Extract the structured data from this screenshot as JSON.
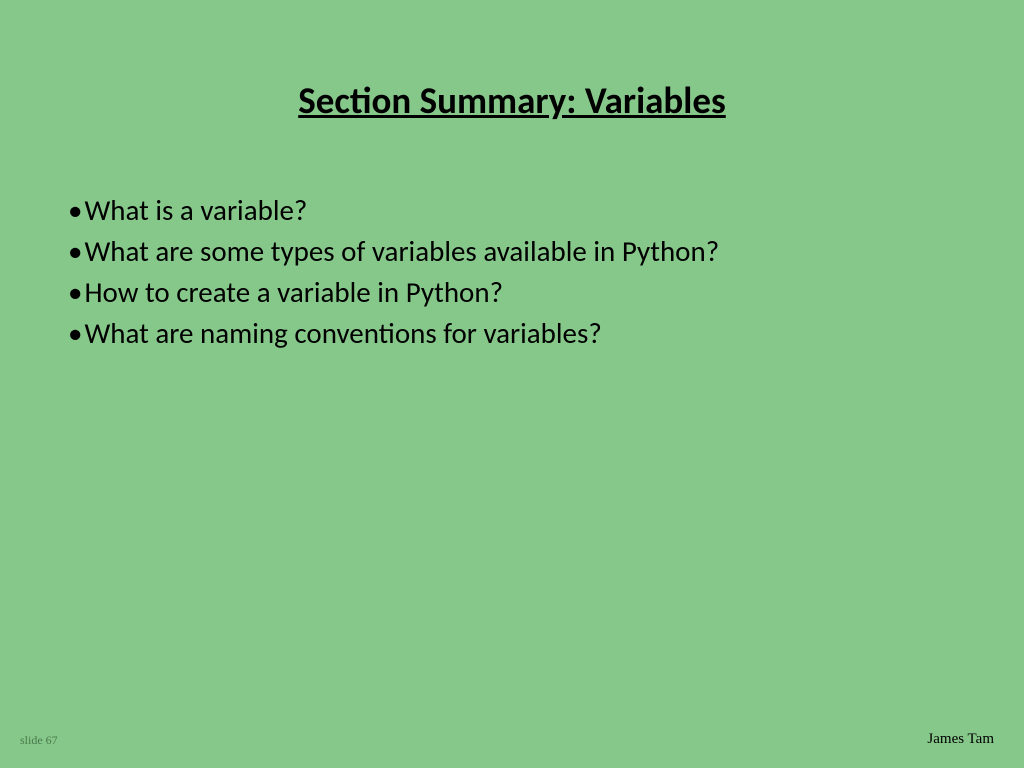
{
  "slide": {
    "title": "Section Summary: Variables",
    "bullets": [
      "What is a variable?",
      "What are some types of variables available in Python?",
      "How to create a variable in Python?",
      "What are naming conventions for variables?"
    ],
    "slide_number": "slide 67",
    "author": "James Tam"
  }
}
